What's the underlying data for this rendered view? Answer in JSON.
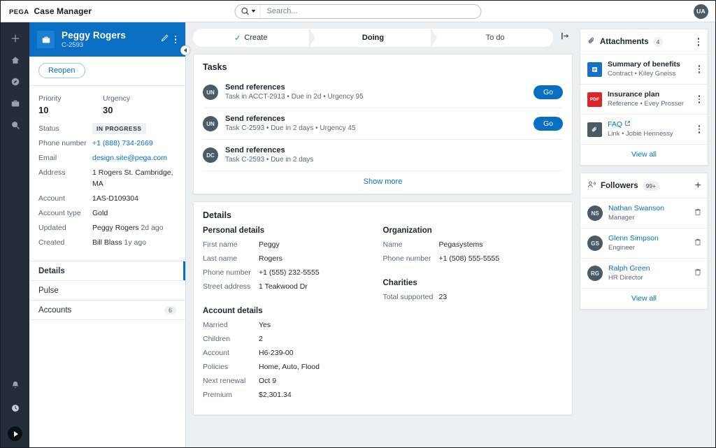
{
  "header": {
    "brand_logo": "PEGA",
    "app_name": "Case Manager",
    "search_placeholder": "Search...",
    "search_icon": "search-icon",
    "user_initials": "UA"
  },
  "rail": {
    "items": [
      {
        "icon": "plus-icon",
        "name": "create"
      },
      {
        "icon": "home-icon",
        "name": "home"
      },
      {
        "icon": "compass-icon",
        "name": "dashboard"
      },
      {
        "icon": "briefcase-icon",
        "name": "cases"
      },
      {
        "icon": "search-circle-icon",
        "name": "explore"
      }
    ],
    "bottom_items": [
      {
        "icon": "bell-icon",
        "name": "notifications"
      },
      {
        "icon": "clock-icon",
        "name": "recents"
      },
      {
        "icon": "play-icon",
        "name": "start"
      }
    ]
  },
  "case": {
    "icon": "briefcase-icon",
    "name": "Peggy Rogers",
    "id": "C-2593",
    "edit_icon": "pencil-icon",
    "more_icon": "kebab-icon",
    "collapse_icon": "chevron-left-icon",
    "reopen_label": "Reopen",
    "priority_label": "Priority",
    "priority_value": "10",
    "urgency_label": "Urgency",
    "urgency_value": "30",
    "fields": [
      {
        "key": "Status",
        "value": "IN PROGRESS",
        "type": "badge"
      },
      {
        "key": "Phone number",
        "value": "+1 (888) 734-2669",
        "type": "link"
      },
      {
        "key": "Email",
        "value": "design.site@pega.com",
        "type": "link"
      },
      {
        "key": "Address",
        "value": "1 Rogers St. Cambridge, MA",
        "type": "text"
      },
      {
        "key": "Account",
        "value": "1AS-D109304",
        "type": "text"
      },
      {
        "key": "Account type",
        "value": "Gold",
        "type": "text"
      },
      {
        "key": "Updated",
        "value": "Peggy Rogers",
        "ago": "2d ago",
        "type": "link-ago"
      },
      {
        "key": "Created",
        "value": "Bill Blass",
        "ago": "1y ago",
        "type": "link-ago"
      }
    ],
    "tabs": [
      {
        "label": "Details",
        "active": true,
        "count": ""
      },
      {
        "label": "Pulse",
        "active": false,
        "count": ""
      },
      {
        "label": "Accounts",
        "active": false,
        "count": "6"
      }
    ]
  },
  "stages": {
    "items": [
      {
        "label": "Create",
        "state": "done",
        "check": "✓"
      },
      {
        "label": "Doing",
        "state": "current",
        "check": ""
      },
      {
        "label": "To do",
        "state": "todo",
        "check": ""
      }
    ],
    "collapse_panel_icon": "collapse-right-icon"
  },
  "tasks": {
    "title": "Tasks",
    "show_more": "Show more",
    "items": [
      {
        "initials": "UN",
        "name": "Send references",
        "meta": "Task in ACCT-2913 • Due in 2d • Urgency 95",
        "action": "Go"
      },
      {
        "initials": "UN",
        "name": "Send references",
        "meta": "Task C-2593 • Due in 2 days • Urgency 45",
        "action": "Go"
      },
      {
        "initials": "DC",
        "name": "Send references",
        "meta": "Task C-2593 • Due in 2 days",
        "action": ""
      }
    ]
  },
  "details": {
    "title": "Details",
    "left_sections": [
      {
        "title": "Personal details",
        "rows": [
          {
            "key": "First name",
            "value": "Peggy"
          },
          {
            "key": "Last name",
            "value": "Rogers"
          },
          {
            "key": "Phone number",
            "value": "+1 (555) 232-5555"
          },
          {
            "key": "Street address",
            "value": "1 Teakwood Dr"
          }
        ]
      },
      {
        "title": "Account details",
        "rows": [
          {
            "key": "Married",
            "value": "Yes"
          },
          {
            "key": "Children",
            "value": "2"
          },
          {
            "key": "Account",
            "value": "H6-239-00"
          },
          {
            "key": "Policies",
            "value": "Home, Auto, Flood"
          },
          {
            "key": "Next renewal",
            "value": "Oct 9"
          },
          {
            "key": "Premium",
            "value": "$2,301.34"
          }
        ]
      }
    ],
    "right_sections": [
      {
        "title": "Organization",
        "rows": [
          {
            "key": "Name",
            "value": "Pegasystems"
          },
          {
            "key": "Phone number",
            "value": "+1 (508) 555-5555"
          }
        ]
      },
      {
        "title": "Charities",
        "rows": [
          {
            "key": "Total supported",
            "value": "23"
          }
        ]
      }
    ]
  },
  "attachments": {
    "icon": "paperclip-icon",
    "title": "Attachments",
    "count": "4",
    "more_icon": "kebab-icon",
    "view_all": "View all",
    "items": [
      {
        "kind": "doc",
        "badge": "",
        "color": "#1b6fc4",
        "name": "Summary of benefits",
        "sub": "Contract • Kiley Gneiss",
        "is_link": false,
        "external": false
      },
      {
        "kind": "pdf",
        "badge": "PDF",
        "color": "#d7262c",
        "name": "Insurance plan",
        "sub": "Reference • Evey Prosser",
        "is_link": false,
        "external": false
      },
      {
        "kind": "link",
        "badge": "",
        "color": "#4c5a66",
        "name": "FAQ",
        "sub": "Link • Jobie Hennessy",
        "is_link": true,
        "external": true
      }
    ]
  },
  "followers": {
    "icon": "followers-icon",
    "title": "Followers",
    "count": "99+",
    "add_label": "+",
    "view_all": "View all",
    "items": [
      {
        "initials": "NS",
        "name": "Nathan Swanson",
        "role": "Manager",
        "delete_icon": "trash-icon"
      },
      {
        "initials": "GS",
        "name": "Glenn Simpson",
        "role": "Engineer",
        "delete_icon": "trash-icon"
      },
      {
        "initials": "RG",
        "name": "Ralph Green",
        "role": "HR Director",
        "delete_icon": "trash-icon"
      }
    ]
  },
  "colors": {
    "brand_blue": "#0a6fc2",
    "rail_dark": "#252d38",
    "page_bg": "#eceff1",
    "success_green": "#18a04a",
    "pdf_red": "#d7262c"
  }
}
